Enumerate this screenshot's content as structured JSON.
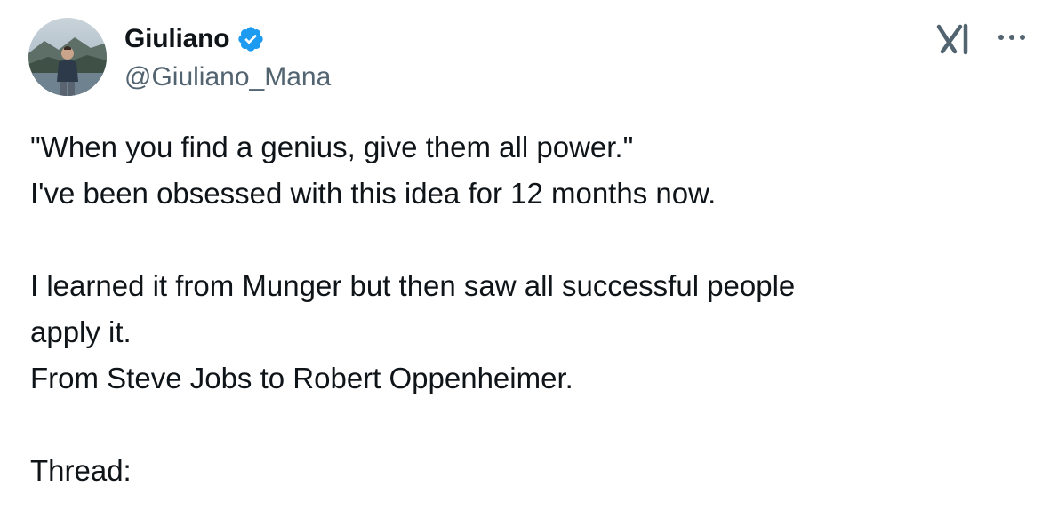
{
  "author": {
    "display_name": "Giuliano",
    "handle": "@Giuliano_Mana",
    "verified": true,
    "avatar_icon": "profile-photo"
  },
  "header_icons": {
    "logo": "x-grok-logo-icon",
    "more": "more-options-icon"
  },
  "colors": {
    "verified_blue": "#1d9bf0",
    "text": "#0f1419",
    "secondary_text": "#536471",
    "icon_gray": "#536471"
  },
  "tweet": {
    "lines": [
      "\"When you find a genius, give them all power.\"",
      "I've been obsessed with this idea for 12 months now.",
      "",
      "I learned it from Munger but then saw all successful people",
      "apply it.",
      "From Steve Jobs to Robert Oppenheimer.",
      "",
      "Thread:"
    ]
  }
}
